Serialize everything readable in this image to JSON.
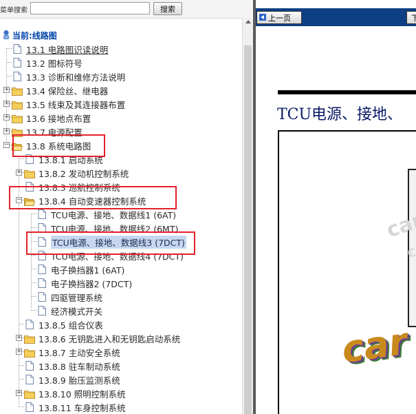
{
  "search": {
    "label": "菜单搜索",
    "value": "",
    "button_label": "搜索"
  },
  "tree": {
    "root_label": "当前:线路图",
    "items": [
      "13.1 电路图识读说明",
      "13.2 图标符号",
      "13.3 诊断和维修方法说明",
      "13.4 保险丝、继电器",
      "13.5 线束及其连接器布置",
      "13.6 接地点布置",
      "13.7 电源配置",
      "13.8 系统电路图",
      "13.8.1 启动系统",
      "13.8.2 发动机控制系统",
      "13.8.3 巡航控制系统",
      "13.8.4 自动变速器控制系统",
      "TCU电源、接地、数据线1 (6AT)",
      "TCU电源、接地、数据线2 (6MT)",
      "TCU电源、接地、数据线3 (7DCT)",
      "TCU电源、接地、数据线4 (7DCT)",
      "电子换挡器1 (6AT)",
      "电子换挡器2 (7DCT)",
      "四驱管理系统",
      "经济模式开关",
      "13.8.5 组合仪表",
      "13.8.6 无钥匙进入和无钥匙启动系统",
      "13.8.7 主动安全系统",
      "13.8.8 驻车制动系统",
      "13.8.9 胎压监测系统",
      "13.8.10 照明控制系统",
      "13.8.11 车身控制系统"
    ]
  },
  "right": {
    "prev_label": "上一页",
    "next_label": "下",
    "page_title": "TCU电源、接地、",
    "watermark": "car",
    "logo_text": "car"
  },
  "colors": {
    "highlight": "#e4202a",
    "toolbar": "#0f3f85",
    "selected": "#c7d7ee",
    "title": "#0a1a66"
  }
}
